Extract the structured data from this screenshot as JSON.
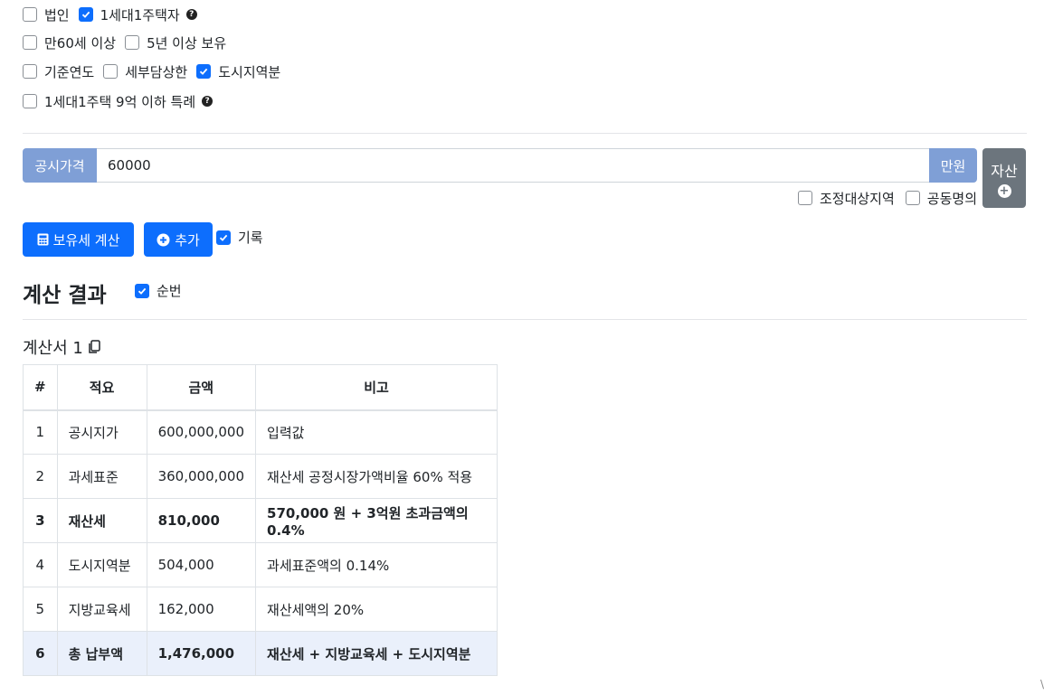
{
  "options": {
    "row1": [
      {
        "label": "법인",
        "checked": false,
        "help": false
      },
      {
        "label": "1세대1주택자",
        "checked": true,
        "help": true
      }
    ],
    "row2": [
      {
        "label": "만60세 이상",
        "checked": false
      },
      {
        "label": "5년 이상 보유",
        "checked": false
      }
    ],
    "row3": [
      {
        "label": "기준연도",
        "checked": false
      },
      {
        "label": "세부담상한",
        "checked": false
      },
      {
        "label": "도시지역분",
        "checked": true
      }
    ],
    "row4": [
      {
        "label": "1세대1주택 9억 이하 특례",
        "checked": false,
        "help": true
      }
    ],
    "help_glyph": "?"
  },
  "price_input": {
    "prefix": "공시가격",
    "value": "60000",
    "suffix": "만원"
  },
  "asset_button": {
    "label": "자산",
    "icon": "plus-circle-icon",
    "plus_glyph": "+"
  },
  "sub_options": [
    {
      "label": "조정대상지역",
      "checked": false
    },
    {
      "label": "공동명의",
      "checked": false
    }
  ],
  "actions": {
    "calc_label": "보유세 계산",
    "calc_icon": "calculator-icon",
    "add_label": "추가",
    "add_icon": "plus-circle-icon",
    "record_label": "기록",
    "record_checked": true
  },
  "result": {
    "title": "계산 결과",
    "order_label": "순번",
    "order_checked": true,
    "sheet_title": "계산서 1",
    "copy_icon": "copy-icon",
    "columns": [
      "#",
      "적요",
      "금액",
      "비고"
    ],
    "rows": [
      {
        "no": "1",
        "item": "공시지가",
        "amount": "600,000,000",
        "note": "입력값",
        "style": "normal"
      },
      {
        "no": "2",
        "item": "과세표준",
        "amount": "360,000,000",
        "note": "재산세 공정시장가액비율 60% 적용",
        "style": "normal"
      },
      {
        "no": "3",
        "item": "재산세",
        "amount": "810,000",
        "note": "570,000 원 + 3억원 초과금액의 0.4%",
        "style": "bold"
      },
      {
        "no": "4",
        "item": "도시지역분",
        "amount": "504,000",
        "note": "과세표준액의 0.14%",
        "style": "normal"
      },
      {
        "no": "5",
        "item": "지방교육세",
        "amount": "162,000",
        "note": "재산세액의 20%",
        "style": "normal"
      },
      {
        "no": "6",
        "item": "총 납부액",
        "amount": "1,476,000",
        "note": "재산세 + 지방교육세 + 도시지역분",
        "style": "total"
      }
    ]
  },
  "corner_mark": "\\",
  "colors": {
    "primary": "#0d6efd",
    "input_addon": "#7f9fd6",
    "secondary": "#6c757d",
    "total_row": "#eaf0fb"
  }
}
